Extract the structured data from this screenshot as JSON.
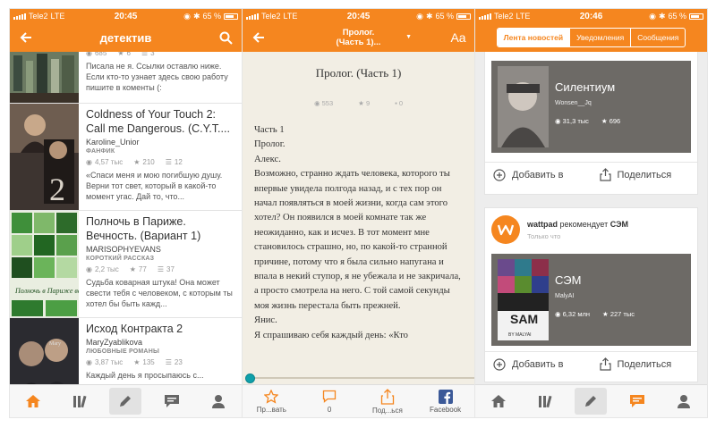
{
  "colors": {
    "accent": "#f5861f",
    "reader_bg": "#f2eee4",
    "feed_bg": "#ededed"
  },
  "status": {
    "screen1": {
      "carrier": "Tele2",
      "network": "LTE",
      "time": "20:45",
      "battery": "65 %"
    },
    "screen2": {
      "carrier": "Tele2",
      "network": "LTE",
      "time": "20:45",
      "battery": "65 %"
    },
    "screen3": {
      "carrier": "Tele2",
      "network": "LTE",
      "time": "20:46",
      "battery": "65 %"
    }
  },
  "search_screen": {
    "title": "детектив",
    "stories": [
      {
        "title": "",
        "author": "",
        "genre": "",
        "reads": "685",
        "votes": "6",
        "parts": "3",
        "desc": "Писала не я. Ссылки оставлю ниже. Если кто-то узнает здесь свою работу пишите в коменты (:"
      },
      {
        "title": "Coldness of Your Touch 2: Call me Dangerous. (C.Y.T....",
        "author": "Karoline_Unior",
        "genre": "ФАНФИК",
        "reads": "4,57 тыс",
        "votes": "210",
        "parts": "12",
        "desc": "«Спаси меня и мою погибшую душу. Верни тот свет, который в какой-то момент угас. Дай то, что..."
      },
      {
        "title": "Полночь в Париже. Вечность. (Вариант 1)",
        "author": "MARISOPHYEVANS",
        "genre": "КОРОТКИЙ РАССКАЗ",
        "reads": "2,2 тыс",
        "votes": "77",
        "parts": "37",
        "desc": "Судьба коварная штука! Она может свести тебя с человеком, с которым ты хотел бы быть кажд..."
      },
      {
        "title": "Исход Контракта 2",
        "author": "MaryZyablikova",
        "genre": "ЛЮБОВНЫЕ РОМАНЫ",
        "reads": "3,87 тыс",
        "votes": "135",
        "parts": "23",
        "desc": "Каждый день я просыпаюсь с..."
      }
    ],
    "cover_texts": {
      "cover2": "2",
      "cover3": "Полночь в Париже вечность",
      "cover4": "Mary"
    },
    "tabs": [
      "home-icon",
      "library-icon",
      "write-icon",
      "messages-icon",
      "profile-icon"
    ]
  },
  "reader_screen": {
    "title_line1": "Пролог.",
    "title_line2": "(Часть 1)...",
    "font_button": "Aa",
    "chapter_title": "Пролог. (Часть 1)",
    "reads": "553",
    "votes": "9",
    "comments": "0",
    "paragraphs": [
      "Часть 1",
      "Пролог.",
      "Алекс.",
      "Возможно, странно ждать человека, которого ты впервые увидела полгода назад, и с тех пор он начал появляться в моей жизни, когда сам этого хотел? Он появился в моей комнате так же неожиданно, как и исчез. В тот момент мне становилось страшно, но, по какой-то странной причине, потому что я была сильно напугана и впала в некий ступор, я не убежала и не закричала, а просто смотрела на него. С той самой секунды моя жизнь перестала быть прежней.",
      "Янис.",
      "Я спрашиваю себя каждый день: «Кто"
    ],
    "progress": 0.0,
    "bottom": {
      "vote": "Пр...вать",
      "comments": "0",
      "share": "Под...ься",
      "facebook": "Facebook"
    }
  },
  "feed_screen": {
    "tabs": [
      "Лента новостей",
      "Уведомления",
      "Сообщения"
    ],
    "card1": {
      "title": "Силентиум",
      "author": "Wonsen__Jq",
      "reads": "31,3 тыс",
      "votes": "696",
      "add": "Добавить в",
      "share": "Поделиться"
    },
    "card2": {
      "recommender": "wattpad",
      "recommends": "рекомендует",
      "story": "СЭМ",
      "time": "Только что",
      "title": "СЭМ",
      "author": "MalyAI",
      "reads": "6,32 млн",
      "votes": "227 тыс",
      "add": "Добавить в",
      "share": "Поделиться",
      "cover_text": "SAM",
      "cover_author": "BY MALYAI"
    },
    "tabbar": [
      "home-icon",
      "library-icon",
      "write-icon",
      "messages-icon",
      "profile-icon"
    ]
  }
}
